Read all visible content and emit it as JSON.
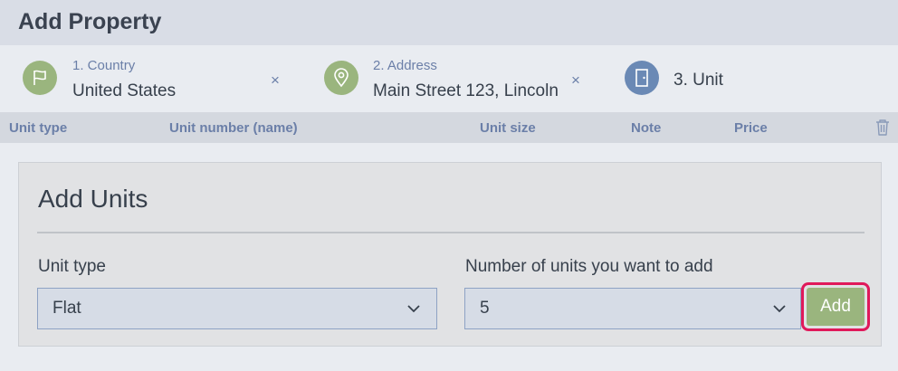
{
  "header": {
    "title": "Add Property"
  },
  "steps": [
    {
      "label": "1. Country",
      "value": "United States",
      "remove": "×",
      "icon": "flag-icon"
    },
    {
      "label": "2. Address",
      "value": "Main Street 123, Lincoln",
      "remove": "×",
      "icon": "map-pin-icon"
    },
    {
      "value": "3. Unit",
      "icon": "door-icon"
    }
  ],
  "table": {
    "columns": [
      "Unit type",
      "Unit number (name)",
      "Unit size",
      "Note",
      "Price"
    ],
    "delete_icon": "trash-icon"
  },
  "panel": {
    "title": "Add Units",
    "unit_type": {
      "label": "Unit type",
      "value": "Flat"
    },
    "count": {
      "label": "Number of units you want to add",
      "value": "5"
    },
    "add_label": "Add"
  },
  "colors": {
    "accent_green": "#9ab57e",
    "accent_blue": "#6a89b5",
    "highlight": "#e0195a"
  }
}
